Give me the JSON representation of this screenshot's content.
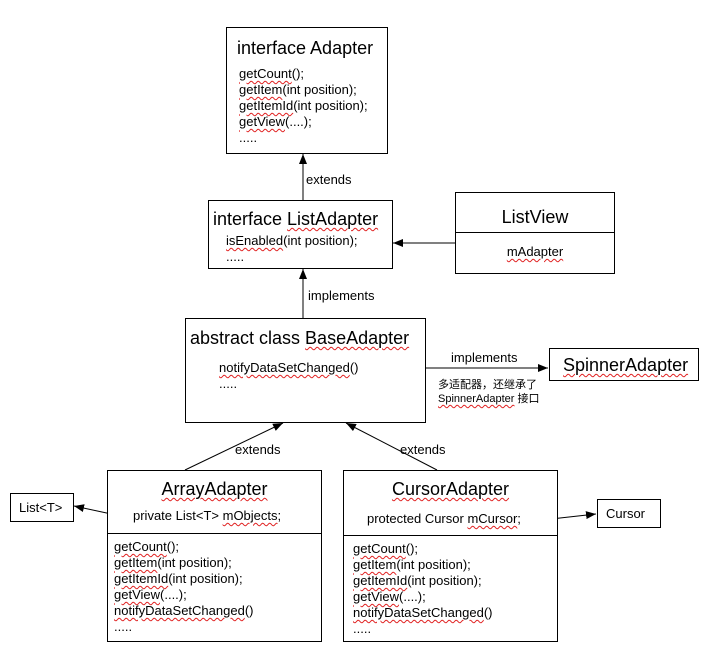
{
  "adapter": {
    "title": "interface Adapter",
    "methods": [
      {
        "w": "getCount",
        "r": "();"
      },
      {
        "w": "getItem",
        "r": "(int position);"
      },
      {
        "w": "getItemId",
        "r": "(int position);"
      },
      {
        "w": "getView",
        "r": "(....);"
      },
      {
        "w": "",
        "r": "....."
      }
    ]
  },
  "list_adapter": {
    "title_a": "interface  ",
    "title_b": "ListAdapter",
    "methods": [
      {
        "w": "isEnabled",
        "r": "(int position);"
      },
      {
        "w": "",
        "r": "....."
      }
    ]
  },
  "list_view": {
    "title": "ListView",
    "field": "mAdapter"
  },
  "base_adapter": {
    "title_a": "abstract class ",
    "title_b": "BaseAdapter",
    "methods": [
      {
        "w": "notifyDataSetChanged",
        "r": "()"
      },
      {
        "w": "",
        "r": "....."
      }
    ]
  },
  "spinner_adapter": {
    "title": "SpinnerAdapter",
    "note_line1": "多适配器，还继承了",
    "note_line2_a": "SpinnerAdapter",
    "note_line2_b": " 接口"
  },
  "array_adapter": {
    "title": "ArrayAdapter",
    "field_a": "private List<T> ",
    "field_b": "mObjects",
    "field_c": ";",
    "methods": [
      {
        "w": "getCount",
        "r": "();"
      },
      {
        "w": "getItem",
        "r": "(int position);"
      },
      {
        "w": "getItemId",
        "r": "(int position);"
      },
      {
        "w": "getView",
        "r": "(....);"
      },
      {
        "w": "notifyDataSetChanged",
        "r": "()"
      },
      {
        "w": "",
        "r": "....."
      }
    ]
  },
  "cursor_adapter": {
    "title": "CursorAdapter",
    "field_a": "protected Cursor ",
    "field_b": "mCursor",
    "field_c": ";",
    "methods": [
      {
        "w": "getCount",
        "r": "();"
      },
      {
        "w": "getItem",
        "r": "(int position);"
      },
      {
        "w": "getItemId",
        "r": "(int position);"
      },
      {
        "w": "getView",
        "r": "(....);"
      },
      {
        "w": "notifyDataSetChanged",
        "r": "()"
      },
      {
        "w": "",
        "r": "....."
      }
    ]
  },
  "list_t": {
    "title": "List<T>"
  },
  "cursor": {
    "title": "Cursor"
  },
  "labels": {
    "extends_top": "extends",
    "implements_mid": "implements",
    "implements_right": "implements",
    "extends_left": "extends",
    "extends_right": "extends"
  }
}
